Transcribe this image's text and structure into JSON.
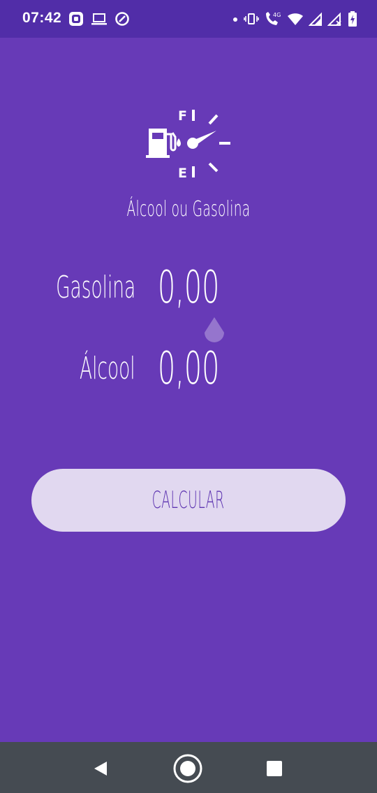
{
  "status_bar": {
    "time": "07:42",
    "network_label": "4G",
    "left_icons": [
      "message-app-icon",
      "laptop-icon",
      "sync-icon"
    ],
    "right_icons": [
      "notification-dot-icon",
      "vibrate-icon",
      "wifi-calling-icon",
      "wifi-icon",
      "signal-icon",
      "signal-no-data-icon",
      "battery-charging-icon"
    ]
  },
  "logo": {
    "full_mark": "F",
    "empty_mark": "E",
    "icon": "fuel-gauge-icon"
  },
  "app": {
    "title": "Álcool ou Gasolina"
  },
  "form": {
    "gasolina_label": "Gasolina",
    "gasolina_placeholder": "0,00",
    "alcool_label": "Álcool",
    "alcool_placeholder": "0,00"
  },
  "button": {
    "label": "CALCULAR"
  },
  "nav_bar": {
    "items": [
      "back-icon",
      "home-icon",
      "recent-apps-icon"
    ]
  },
  "colors": {
    "background": "#673ab7",
    "status_bar": "#512da8",
    "button_bg": "#e1d8f0",
    "button_text": "#5e35b1",
    "nav_bar": "#454b52",
    "cursor_handle": "#9575cd"
  }
}
